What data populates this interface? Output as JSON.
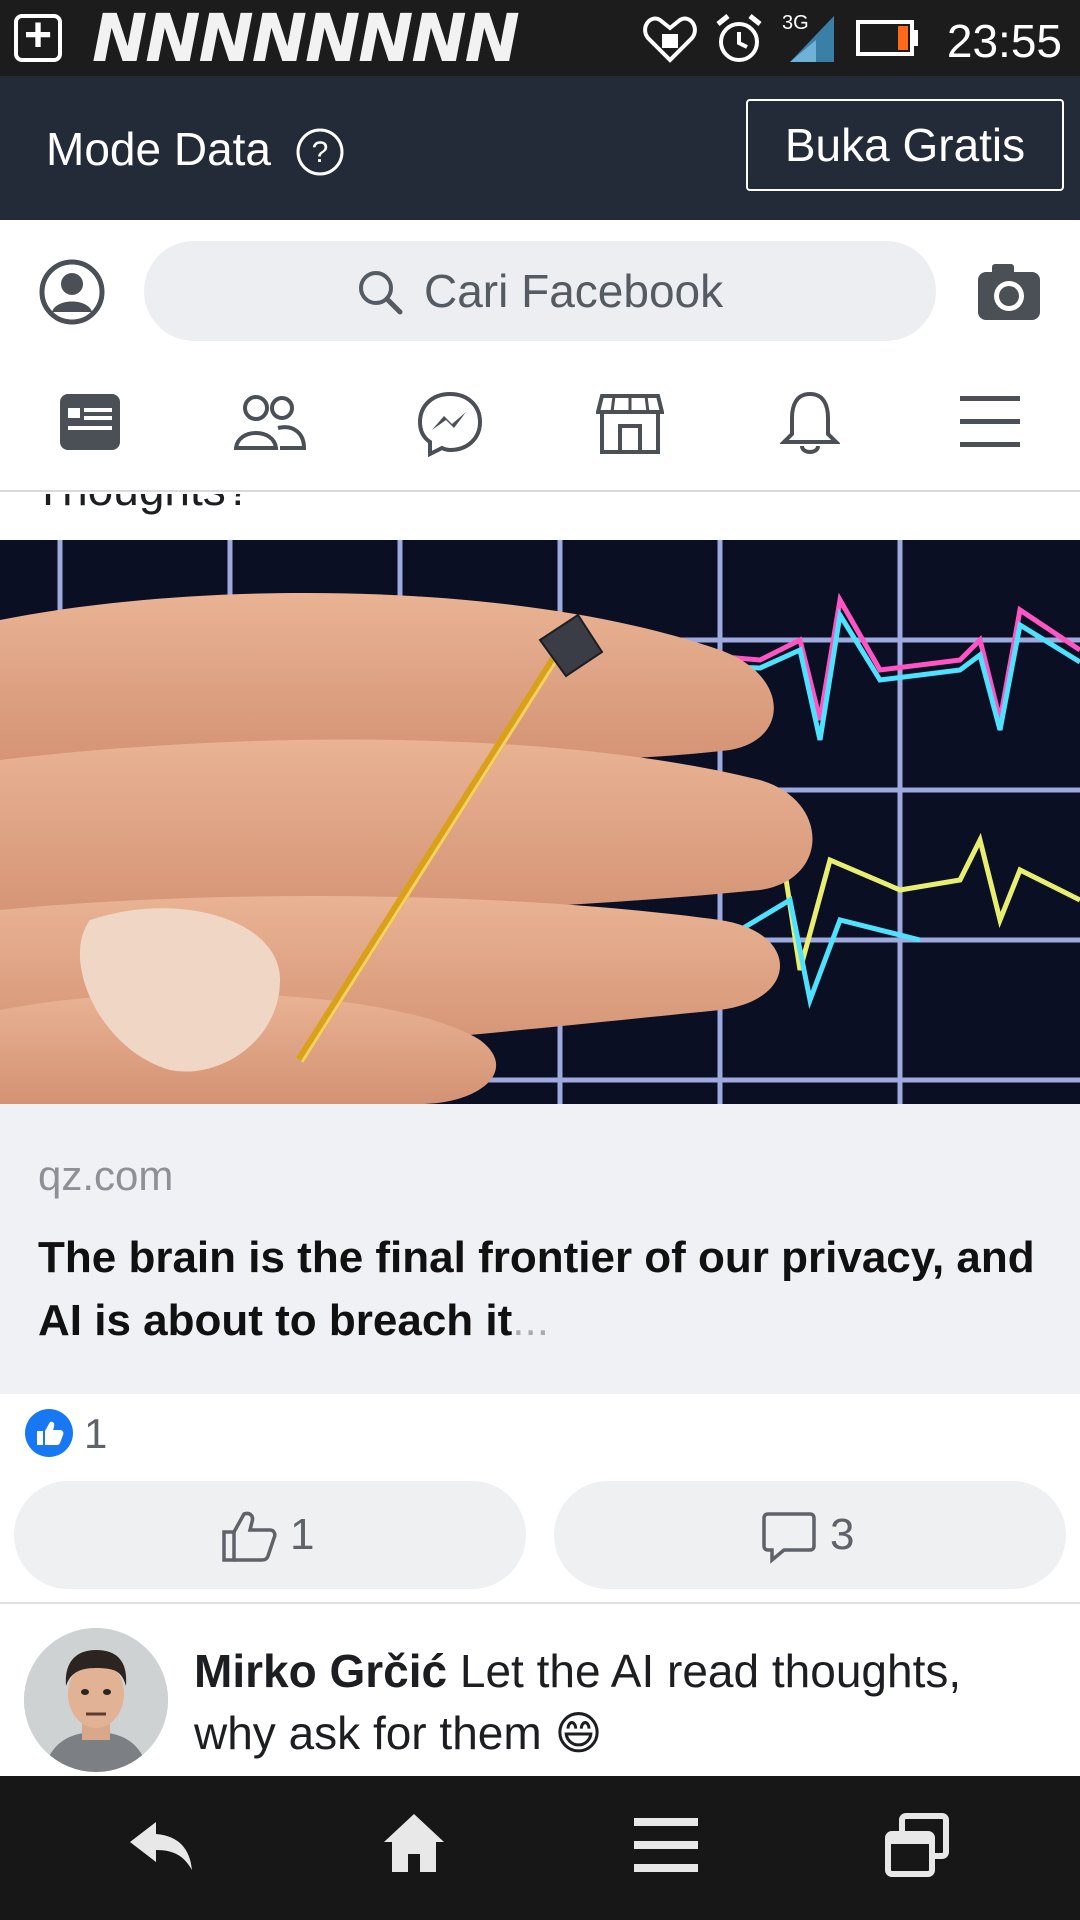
{
  "status_bar": {
    "time": "23:55",
    "network": "3G",
    "notification_text": "NNNNNNNN"
  },
  "data_mode_bar": {
    "label": "Mode Data",
    "free_button": "Buka Gratis"
  },
  "header": {
    "search_placeholder": "Cari Facebook"
  },
  "nav_tabs": [
    "news-feed",
    "friends",
    "messenger",
    "marketplace",
    "notifications",
    "menu"
  ],
  "post": {
    "clipped_text": "Thoughts?",
    "link": {
      "domain": "qz.com",
      "title": "The brain is the final frontier of our privacy, and AI is about to breach it",
      "ellipsis": "..."
    },
    "reaction_count": "1",
    "like_count": "1",
    "comment_count": "3"
  },
  "comment": {
    "author": "Mirko Grčić",
    "text": "Let the AI read thoughts, why ask for them",
    "emoji": "😄"
  },
  "colors": {
    "mode_bar_bg": "#242b38",
    "facebook_blue": "#1877f2",
    "status_bar_bg": "#1c1c1c"
  }
}
